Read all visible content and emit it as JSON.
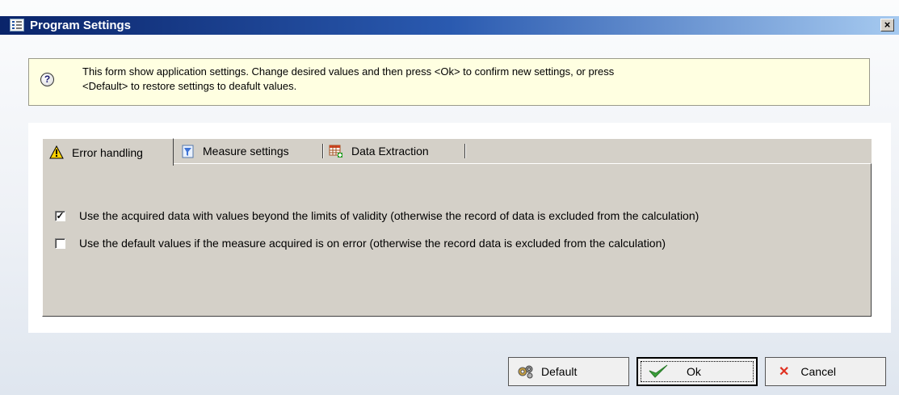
{
  "window": {
    "title": "Program Settings",
    "close_glyph": "×"
  },
  "info": {
    "icon": "help-icon",
    "text_line1": "This form show application settings. Change desired values and then press <Ok> to confirm new settings, or press",
    "text_line2": "<Default> to restore settings to deafult values."
  },
  "tabs": [
    {
      "label": "Error handling",
      "icon": "warning-icon",
      "active": true
    },
    {
      "label": "Measure settings",
      "icon": "measure-icon",
      "active": false
    },
    {
      "label": "Data Extraction",
      "icon": "table-add-icon",
      "active": false
    }
  ],
  "options": [
    {
      "label": "Use the acquired data with values beyond the limits of validity (otherwise the record of data is excluded from the calculation)",
      "checked": true
    },
    {
      "label": "Use the default values if the measure acquired is on error (otherwise the record data is excluded from the calculation)",
      "checked": false
    }
  ],
  "buttons": {
    "default_label": "Default",
    "ok_label": "Ok",
    "cancel_label": "Cancel",
    "cancel_glyph": "✕"
  },
  "colors": {
    "titlebar_start": "#0a246a",
    "info_background": "#ffffe1",
    "panel_face": "#d4d0c8",
    "ok_check": "#3aa03a",
    "cancel_x": "#e03020"
  }
}
